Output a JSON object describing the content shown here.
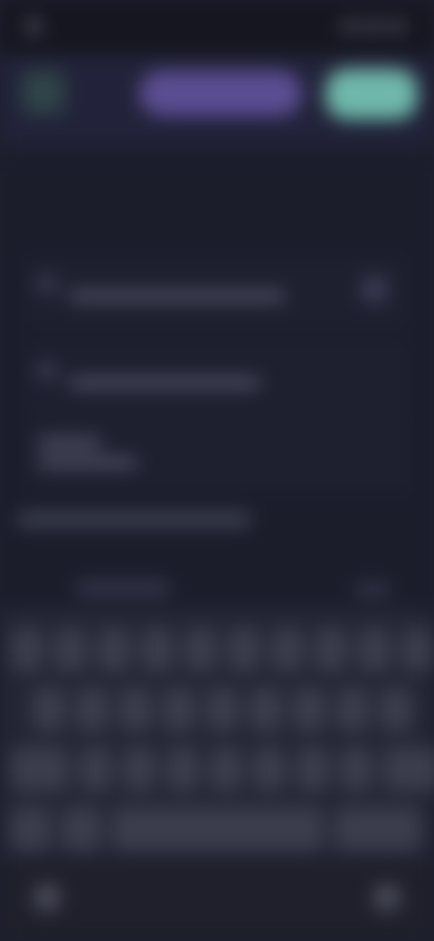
{
  "status": {
    "time": "",
    "battery": ""
  },
  "toolbar": {
    "primary_label": "",
    "accent_label": ""
  },
  "list": {
    "section_title": "",
    "rows": [
      {
        "label": ""
      },
      {
        "label": ""
      },
      {
        "label": ""
      }
    ]
  },
  "keyboard": {
    "row1": [
      "",
      "",
      "",
      "",
      "",
      "",
      "",
      "",
      "",
      ""
    ],
    "row2": [
      "",
      "",
      "",
      "",
      "",
      "",
      "",
      "",
      ""
    ],
    "row3": [
      "",
      "",
      "",
      "",
      "",
      "",
      "",
      ""
    ]
  },
  "colors": {
    "primary": "#5b4d92",
    "accent": "#6fb7aa",
    "background": "#1e1f2e"
  },
  "icons": [
    "back-icon",
    "row-icon",
    "keyboard-hide-icon",
    "mic-icon"
  ]
}
